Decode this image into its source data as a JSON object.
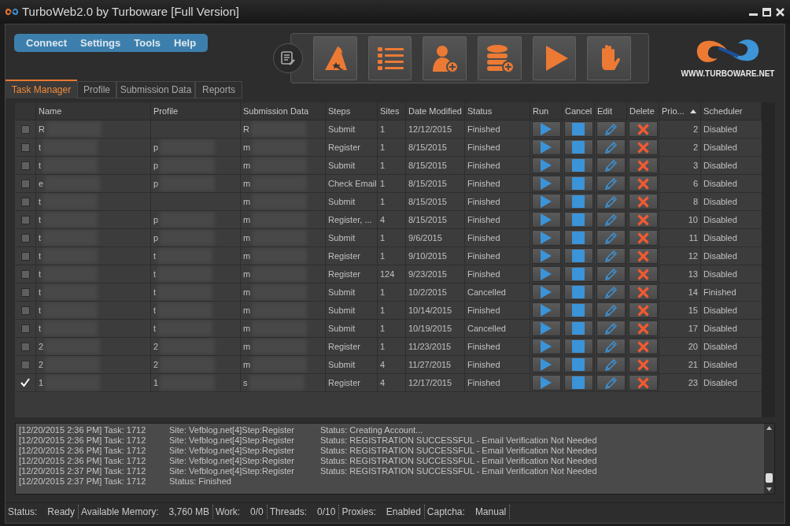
{
  "window": {
    "title": "TurboWeb2.0 by Turboware [Full Version]"
  },
  "menu": [
    "Connect",
    "Settings",
    "Tools",
    "Help"
  ],
  "toolbar": [
    {
      "kind": "wizard"
    },
    {
      "kind": "list"
    },
    {
      "kind": "add-user"
    },
    {
      "kind": "add-database"
    },
    {
      "kind": "play"
    },
    {
      "kind": "stop"
    }
  ],
  "logo": {
    "url": "WWW.TURBOWARE.NET"
  },
  "tabs": [
    {
      "label": "Task Manager",
      "selected": true
    },
    {
      "label": "Profile",
      "selected": false
    },
    {
      "label": "Submission Data",
      "selected": false
    },
    {
      "label": "Reports",
      "selected": false
    }
  ],
  "table": {
    "columns": [
      "Name",
      "Profile",
      "Submission Data",
      "Steps",
      "Sites",
      "Date Modified",
      "Status",
      "Run",
      "Cancel",
      "Edit",
      "Delete",
      "Prio...",
      "Scheduler"
    ],
    "rows": [
      {
        "checked": false,
        "name": "R",
        "profile": "",
        "submission": "R",
        "steps": "Submit",
        "sites": "1",
        "date": "12/12/2015",
        "status": "Finished",
        "priority": "2",
        "scheduler": "Disabled"
      },
      {
        "checked": false,
        "name": "t",
        "profile": "p",
        "submission": "m",
        "steps": "Register",
        "sites": "1",
        "date": "8/15/2015",
        "status": "Finished",
        "priority": "2",
        "scheduler": "Disabled"
      },
      {
        "checked": false,
        "name": "t",
        "profile": "p",
        "submission": "m",
        "steps": "Submit",
        "sites": "1",
        "date": "8/15/2015",
        "status": "Finished",
        "priority": "3",
        "scheduler": "Disabled"
      },
      {
        "checked": false,
        "name": "e",
        "profile": "p",
        "submission": "m",
        "steps": "Check Email",
        "sites": "1",
        "date": "8/15/2015",
        "status": "Finished",
        "priority": "6",
        "scheduler": "Disabled"
      },
      {
        "checked": false,
        "name": "t",
        "profile": "",
        "submission": "m",
        "steps": "Submit",
        "sites": "1",
        "date": "8/15/2015",
        "status": "Finished",
        "priority": "8",
        "scheduler": "Disabled"
      },
      {
        "checked": false,
        "name": "t",
        "profile": "p",
        "submission": "m",
        "steps": "Register, ...",
        "sites": "4",
        "date": "8/15/2015",
        "status": "Finished",
        "priority": "10",
        "scheduler": "Disabled"
      },
      {
        "checked": false,
        "name": "t",
        "profile": "p",
        "submission": "m",
        "steps": "Submit",
        "sites": "1",
        "date": "9/6/2015",
        "status": "Finished",
        "priority": "11",
        "scheduler": "Disabled"
      },
      {
        "checked": false,
        "name": "t",
        "profile": "t",
        "submission": "m",
        "steps": "Register",
        "sites": "1",
        "date": "9/10/2015",
        "status": "Finished",
        "priority": "12",
        "scheduler": "Disabled"
      },
      {
        "checked": false,
        "name": "t",
        "profile": "t",
        "submission": "m",
        "steps": "Register",
        "sites": "124",
        "date": "9/23/2015",
        "status": "Finished",
        "priority": "13",
        "scheduler": "Disabled"
      },
      {
        "checked": false,
        "name": "t",
        "profile": "t",
        "submission": "m",
        "steps": "Submit",
        "sites": "1",
        "date": "10/2/2015",
        "status": "Cancelled",
        "priority": "14",
        "scheduler": "Finished"
      },
      {
        "checked": false,
        "name": "t",
        "profile": "t",
        "submission": "m",
        "steps": "Submit",
        "sites": "1",
        "date": "10/14/2015",
        "status": "Finished",
        "priority": "15",
        "scheduler": "Disabled"
      },
      {
        "checked": false,
        "name": "t",
        "profile": "t",
        "submission": "m",
        "steps": "Submit",
        "sites": "1",
        "date": "10/19/2015",
        "status": "Cancelled",
        "priority": "17",
        "scheduler": "Disabled"
      },
      {
        "checked": false,
        "name": "2",
        "profile": "2",
        "submission": "m",
        "steps": "Register",
        "sites": "1",
        "date": "11/23/2015",
        "status": "Finished",
        "priority": "20",
        "scheduler": "Disabled"
      },
      {
        "checked": false,
        "name": "2",
        "profile": "2",
        "submission": "m",
        "steps": "Submit",
        "sites": "4",
        "date": "11/27/2015",
        "status": "Finished",
        "priority": "21",
        "scheduler": "Disabled"
      },
      {
        "checked": true,
        "name": "1",
        "profile": "1",
        "submission": "s",
        "steps": "Register",
        "sites": "4",
        "date": "12/17/2015",
        "status": "Finished",
        "priority": "23",
        "scheduler": "Disabled"
      }
    ]
  },
  "log": [
    {
      "prefix": "[12/20/2015 2:36 PM] Task: 1712",
      "site": "Site: Vefblog.net[4]Step:Register",
      "message": "Status: Creating Account..."
    },
    {
      "prefix": "[12/20/2015 2:36 PM] Task: 1712",
      "site": "Site: Vefblog.net[4]Step:Register",
      "message": "Status: REGISTRATION SUCCESSFUL - Email Verification Not Needed"
    },
    {
      "prefix": "[12/20/2015 2:36 PM] Task: 1712",
      "site": "Site: Vefblog.net[4]Step:Register",
      "message": "Status: REGISTRATION SUCCESSFUL - Email Verification Not Needed"
    },
    {
      "prefix": "[12/20/2015 2:36 PM] Task: 1712",
      "site": "Site: Vefblog.net[4]Step:Register",
      "message": "Status: REGISTRATION SUCCESSFUL - Email Verification Not Needed"
    },
    {
      "prefix": "[12/20/2015 2:37 PM] Task: 1712",
      "site": "Site: Vefblog.net[4]Step:Register",
      "message": "Status: REGISTRATION SUCCESSFUL - Email Verification Not Needed"
    },
    {
      "prefix": "[12/20/2015 2:37 PM] Task: 1712",
      "site": "Status: Finished"
    }
  ],
  "status_bar": [
    {
      "label": "Status:",
      "value": "Ready"
    },
    {
      "label": "Available Memory:",
      "value": "3,760 MB"
    },
    {
      "label": "Work:",
      "value": "0/0"
    },
    {
      "label": "Threads:",
      "value": "0/10"
    },
    {
      "label": "Proxies:",
      "value": "Enabled"
    },
    {
      "label": "Captcha:",
      "value": "Manual"
    }
  ]
}
